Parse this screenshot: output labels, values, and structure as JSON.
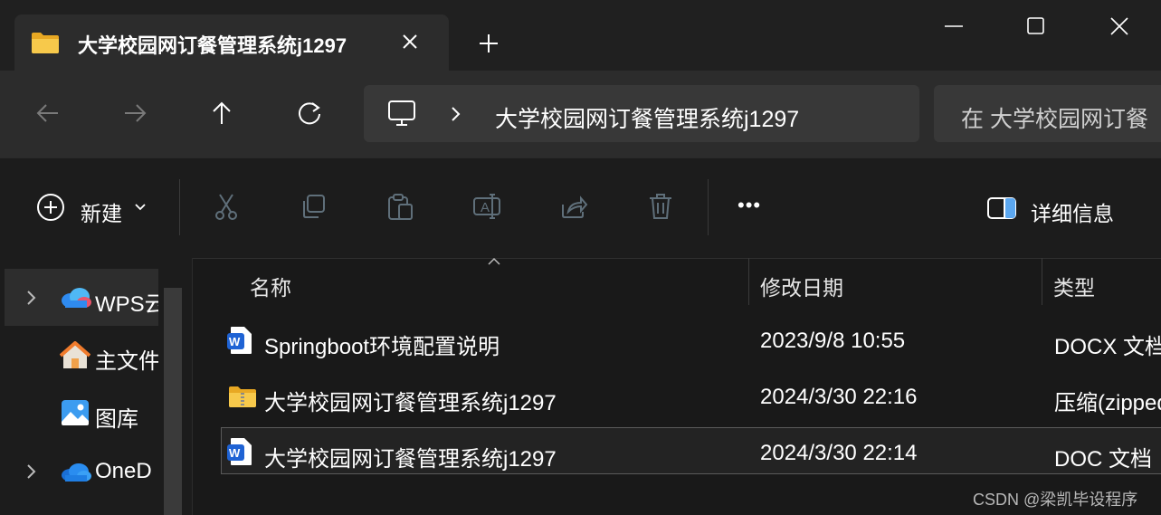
{
  "window": {
    "tab_title": "大学校园网订餐管理系统j1297",
    "icons": {
      "folder": "folder-icon",
      "close": "close-icon",
      "new_tab": "plus-icon",
      "minimize": "minimize-icon",
      "maximize": "maximize-icon",
      "window_close": "close-window-icon"
    }
  },
  "navigation": {
    "breadcrumb": "大学校园网订餐管理系统j1297",
    "search_placeholder": "在 大学校园网订餐",
    "icons": [
      "back-arrow-icon",
      "forward-arrow-icon",
      "up-arrow-icon",
      "refresh-icon",
      "this-pc-icon",
      "chevron-right-icon"
    ]
  },
  "command_bar": {
    "new_label": "新建",
    "details_label": "详细信息",
    "more": "•••",
    "icons": [
      "cut-icon",
      "copy-icon",
      "paste-icon",
      "rename-icon",
      "share-icon",
      "delete-icon",
      "details-pane-icon"
    ]
  },
  "nav_pane": {
    "items": [
      {
        "label": "WPS云",
        "icon": "cloud-icon"
      },
      {
        "label": "主文件",
        "icon": "home-icon"
      },
      {
        "label": "图库",
        "icon": "gallery-icon"
      },
      {
        "label": "OneD",
        "icon": "onedrive-icon"
      }
    ]
  },
  "file_list": {
    "columns": [
      "名称",
      "修改日期",
      "类型"
    ],
    "rows": [
      {
        "name": "Springboot环境配置说明",
        "date": "2023/9/8 10:55",
        "type": "DOCX 文档",
        "icon": "word-document-icon"
      },
      {
        "name": "大学校园网订餐管理系统j1297",
        "date": "2024/3/30 22:16",
        "type": "压缩(zipped)",
        "icon": "zip-folder-icon"
      },
      {
        "name": "大学校园网订餐管理系统j1297",
        "date": "2024/3/30 22:14",
        "type": "DOC 文档",
        "icon": "word-document-icon"
      }
    ]
  },
  "watermark": "CSDN @梁凯毕设程序",
  "colors": {
    "background": "#191919",
    "accent_blue": "#1f63d4",
    "folder_yellow": "#f5c242"
  }
}
